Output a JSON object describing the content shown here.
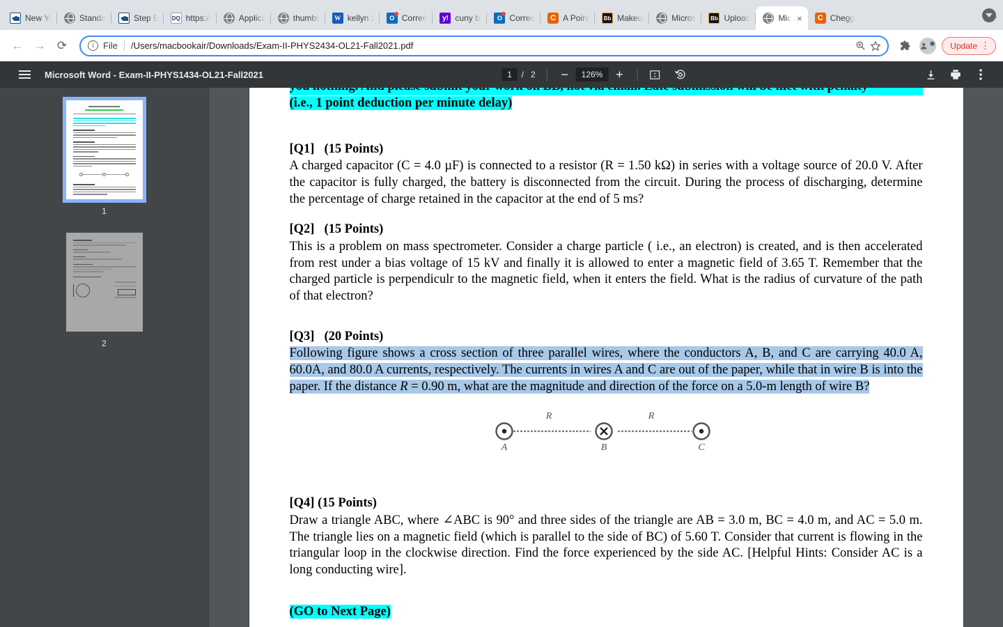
{
  "browser": {
    "tabs": [
      {
        "title": "New Yo",
        "icon": "ny-state-icon",
        "icon_class": "fav-ny",
        "glyph": "",
        "active": false
      },
      {
        "title": "Standa",
        "icon": "globe-icon",
        "icon_class": "fav-globe",
        "glyph": "",
        "active": false
      },
      {
        "title": "Step 5",
        "icon": "ny-state-icon",
        "icon_class": "fav-ny",
        "glyph": "",
        "active": false
      },
      {
        "title": "https://",
        "icon": "pdf-doc-icon",
        "icon_class": "fav-pdf",
        "glyph": "DQ",
        "active": false
      },
      {
        "title": "Applica",
        "icon": "globe-icon",
        "icon_class": "fav-globe",
        "glyph": "",
        "active": false
      },
      {
        "title": "thumbn",
        "icon": "globe-icon",
        "icon_class": "fav-globe",
        "glyph": "",
        "active": false
      },
      {
        "title": "kellyn 2",
        "icon": "word-icon",
        "icon_class": "fav-word",
        "glyph": "W",
        "active": false
      },
      {
        "title": "Correo",
        "icon": "outlook-icon",
        "icon_class": "fav-outlook",
        "glyph": "O",
        "active": false
      },
      {
        "title": "cuny bl",
        "icon": "yahoo-icon",
        "icon_class": "fav-yahoo",
        "glyph": "y!",
        "active": false
      },
      {
        "title": "Correo",
        "icon": "outlook-icon",
        "icon_class": "fav-outlook",
        "glyph": "O",
        "active": false
      },
      {
        "title": "A Point",
        "icon": "chegg-icon",
        "icon_class": "fav-chegg",
        "glyph": "C",
        "active": false
      },
      {
        "title": "Makeup",
        "icon": "blackboard-icon",
        "icon_class": "fav-bb",
        "glyph": "Bb",
        "active": false
      },
      {
        "title": "Micros",
        "icon": "globe-icon",
        "icon_class": "fav-globe",
        "glyph": "",
        "active": false
      },
      {
        "title": "Upload",
        "icon": "blackboard-icon",
        "icon_class": "fav-bb",
        "glyph": "Bb",
        "active": false
      },
      {
        "title": "Mic",
        "icon": "globe-icon",
        "icon_class": "fav-globe",
        "glyph": "",
        "active": true
      },
      {
        "title": "Chegg",
        "icon": "chegg-icon",
        "icon_class": "fav-chegg",
        "glyph": "C",
        "active": false
      }
    ],
    "new_tab_label": "+",
    "close_label": "×",
    "back_label": "←",
    "forward_label": "→",
    "reload_label": "⟳",
    "omnibox": {
      "info_glyph": "i",
      "scheme_label": "File",
      "url": "/Users/macbookair/Downloads/Exam-II-PHYS2434-OL21-Fall2021.pdf",
      "zoom_icon": "zoom-in-icon",
      "bookmark_icon": "star-icon"
    },
    "extensions_icon": "puzzle-icon",
    "profile_icon": "profile-avatar-icon",
    "update_label": "Update",
    "menu_label": "⋮"
  },
  "pdf_viewer": {
    "menu_icon": "hamburger-menu-icon",
    "title": "Microsoft Word - Exam-II-PHYS1434-OL21-Fall2021",
    "current_page": "1",
    "page_separator": "/",
    "total_pages": "2",
    "zoom_out_label": "−",
    "zoom_level": "126%",
    "zoom_in_label": "+",
    "fit_icon": "fit-to-page-icon",
    "rotate_icon": "rotate-icon",
    "download_icon": "download-icon",
    "print_icon": "print-icon",
    "more_icon": "more-options-icon",
    "thumbnails": [
      {
        "number": "1",
        "selected": true
      },
      {
        "number": "2",
        "selected": false
      }
    ]
  },
  "document": {
    "clipped_top_line": "you nothing. And please submit your work on BB, not via email. Late submission will be met with penalty",
    "penalty_line": "(i.e., 1 point deduction per minute delay)",
    "questions": [
      {
        "tag": "[Q1]",
        "points": "(15 Points)",
        "body": "A charged capacitor (C = 4.0 µF) is connected to a resistor (R = 1.50 kΩ) in series with a voltage source of 20.0 V. After the capacitor is fully charged, the battery is disconnected from the circuit. During the process of discharging, determine the percentage of charge retained in the capacitor at the end of 5 ms?"
      },
      {
        "tag": "[Q2]",
        "points": "(15 Points)",
        "body": "This is a problem on mass spectrometer. Consider a charge particle ( i.e., an electron) is created, and is then accelerated from rest under a bias voltage of 15 kV and finally it is allowed to enter a magnetic field of 3.65 T. Remember that the charged particle is perpendiculr to the magnetic field, when it enters the field. What is the radius of curvature of the path of that electron?"
      },
      {
        "tag": "[Q3]",
        "points": "(20 Points)",
        "body_part1": "Following figure shows a cross section of three parallel wires, where the conductors A, B, and C are carrying 40.0 A, 60.0A, and 80.0 A currents, respectively. The currents in wires A and C are out of the paper, while that in wire B is into the paper. If the distance ",
        "body_r": "R",
        "body_part2": " = 0.90 m, what are the magnitude and direction of the force on a 5.0-m length of wire B?"
      },
      {
        "tag": "[Q4] (15 Points)",
        "points": "",
        "body": "Draw a triangle ABC, where ∠ABC is 90° and three sides of the triangle are AB = 3.0 m, BC = 4.0 m, and AC = 5.0 m. The triangle lies on a magnetic field (which is parallel to the side of BC) of 5.60 T. Consider that current is flowing in the triangular loop in the clockwise direction. Find the force experienced by the side AC. [Helpful Hints: Consider AC is a long conducting wire]."
      }
    ],
    "figure": {
      "name": "three-parallel-wires-cross-section",
      "wires": [
        {
          "label": "A",
          "direction": "out-of-page",
          "symbol": "⊙"
        },
        {
          "label": "B",
          "direction": "into-page",
          "symbol": "⊗"
        },
        {
          "label": "C",
          "direction": "out-of-page",
          "symbol": "⊙"
        }
      ],
      "distance_labels": [
        "R",
        "R"
      ]
    },
    "next_page_note": "(GO to Next Page)"
  },
  "colors": {
    "highlight_cyan": "#00ffff",
    "highlight_selection": "#a8c8e8",
    "browser_accent": "#4285f4",
    "update_red": "#d93025",
    "pdf_toolbar": "#323639",
    "pdf_backdrop": "#525659",
    "thumb_pane": "#424649"
  }
}
